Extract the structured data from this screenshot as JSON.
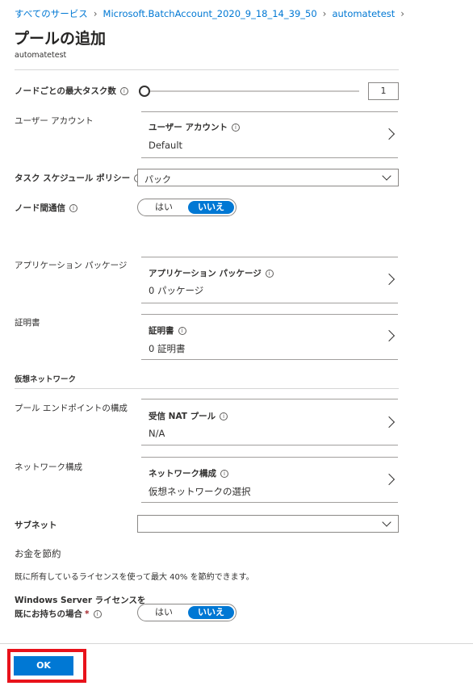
{
  "breadcrumb": [
    {
      "label": "すべてのサービス"
    },
    {
      "label": "Microsoft.BatchAccount_2020_9_18_14_39_50"
    },
    {
      "label": "automatetest"
    }
  ],
  "breadcrumb_separator": "›",
  "title": "プールの追加",
  "subtitle": "automatetest",
  "info_glyph": "i",
  "tasks_per_node": {
    "label": "ノードごとの最大タスク数",
    "value": "1"
  },
  "user_account": {
    "row_label": "ユーザー アカウント",
    "title": "ユーザー アカウント",
    "value": "Default"
  },
  "task_scheduling": {
    "label": "タスク スケジュール ポリシー",
    "value": "パック"
  },
  "inter_node": {
    "label": "ノード間通信",
    "yes": "はい",
    "no": "いいえ",
    "selected": "いいえ"
  },
  "app_packages": {
    "row_label": "アプリケーション パッケージ",
    "title": "アプリケーション パッケージ",
    "value": "0 パッケージ"
  },
  "certificates": {
    "row_label": "証明書",
    "title": "証明書",
    "value": "0 証明書"
  },
  "virtual_network_section": "仮想ネットワーク",
  "endpoint_config": {
    "row_label": "プール エンドポイントの構成",
    "title": "受信 NAT プール",
    "value": "N/A"
  },
  "network_config": {
    "row_label": "ネットワーク構成",
    "title": "ネットワーク構成",
    "value": "仮想ネットワークの選択"
  },
  "subnet": {
    "label": "サブネット",
    "value": ""
  },
  "savings": {
    "title": "お金を節約",
    "description": "既に所有しているライセンスを使って最大 40% を節約できます。"
  },
  "windows_license": {
    "label_line1": "Windows Server ライセンスを",
    "label_line2": "既にお持ちの場合",
    "required": "*",
    "yes": "はい",
    "no": "いいえ",
    "selected": "いいえ"
  },
  "ok_label": "OK",
  "colors": {
    "accent": "#0078d4",
    "highlight": "#e8121b",
    "text": "#323130"
  }
}
